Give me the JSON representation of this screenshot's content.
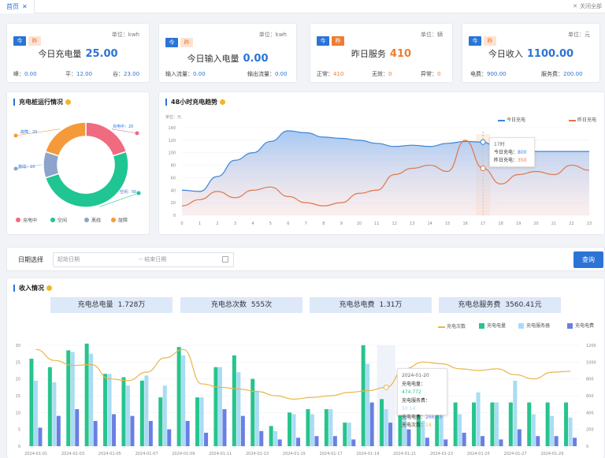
{
  "tabs": {
    "home_label": "首页",
    "close_all": "关闭全部"
  },
  "cards": [
    {
      "today_badge": "今",
      "yest_badge": "昨",
      "unit": "单位：kwh",
      "title": "今日充电量",
      "value": "25.00",
      "subs": [
        {
          "label": "峰：",
          "value": "0.00"
        },
        {
          "label": "平：",
          "value": "12.00"
        },
        {
          "label": "谷：",
          "value": "23.00"
        }
      ]
    },
    {
      "today_badge": "今",
      "yest_badge": "昨",
      "unit": "单位：kwh",
      "title": "今日输入电量",
      "value": "0.00",
      "subs": [
        {
          "label": "输入流量：",
          "value": "0.00"
        },
        {
          "label": "输出流量：",
          "value": "0.00"
        }
      ]
    },
    {
      "today_badge": "今",
      "yest_badge": "昨",
      "unit": "单位：辆",
      "title": "昨日服务",
      "value": "410",
      "subs": [
        {
          "label": "正常：",
          "value": "410"
        },
        {
          "label": "无效：",
          "value": "0"
        },
        {
          "label": "异常：",
          "value": "0"
        }
      ]
    },
    {
      "today_badge": "今",
      "yest_badge": "昨",
      "unit": "单位：元",
      "title": "今日收入",
      "value": "1100.00",
      "subs": [
        {
          "label": "电费：",
          "value": "900.00"
        },
        {
          "label": "服务费：",
          "value": "200.00"
        }
      ]
    }
  ],
  "pile_status": {
    "title": "充电桩运行情况",
    "chart_data": {
      "type": "pie",
      "categories": [
        "充电中",
        "空闲",
        "离线",
        "故障"
      ],
      "values": [
        20,
        50,
        10,
        20
      ],
      "colors": [
        "#f06b7f",
        "#1fc592",
        "#8da3c9",
        "#f59a3a"
      ],
      "slice_labels": [
        "充电中：20",
        "空闲：50",
        "离线：10",
        "故障：20"
      ]
    }
  },
  "trend48": {
    "title": "48小时充电趋势",
    "unit_label": "单位：元",
    "legend": [
      "今日充电",
      "昨日充电"
    ],
    "tooltip": {
      "title": "17时",
      "lines": [
        {
          "label": "今日充电：",
          "value": "800"
        },
        {
          "label": "昨日充电：",
          "value": "350"
        }
      ]
    },
    "chart_data": {
      "type": "area",
      "x": [
        "0",
        "1",
        "2",
        "3",
        "4",
        "5",
        "6",
        "7",
        "8",
        "9",
        "10",
        "11",
        "12",
        "13",
        "14",
        "15",
        "16",
        "17",
        "18",
        "19",
        "20",
        "21",
        "22",
        "23"
      ],
      "ylim": [
        0,
        140
      ],
      "yticks": [
        "0",
        "20",
        "40",
        "60",
        "80",
        "100",
        "120",
        "140"
      ],
      "series": [
        {
          "name": "今日充电",
          "color": "#3b86d8",
          "values": [
            40,
            38,
            62,
            88,
            100,
            118,
            135,
            132,
            125,
            123,
            120,
            115,
            110,
            112,
            110,
            115,
            118,
            117,
            102,
            102,
            102,
            102,
            102,
            102
          ]
        },
        {
          "name": "昨日充电",
          "color": "#e0764a",
          "values": [
            15,
            25,
            38,
            28,
            40,
            45,
            30,
            20,
            15,
            20,
            35,
            40,
            65,
            75,
            80,
            70,
            120,
            75,
            50,
            65,
            70,
            65,
            80,
            72
          ]
        }
      ]
    }
  },
  "filter": {
    "label": "日期选择",
    "start_placeholder": "起始日期",
    "end_placeholder": "结束日期",
    "query_button": "查询"
  },
  "income": {
    "title": "收入情况",
    "summary": [
      {
        "label": "充电总电量",
        "value": "1.728万"
      },
      {
        "label": "充电总次数",
        "value": "555次"
      },
      {
        "label": "充电总电费",
        "value": "1.31万"
      },
      {
        "label": "充电总服务费",
        "value": "3560.41元"
      }
    ],
    "legend": [
      "充电次数",
      "充电电量",
      "充电服务器",
      "充电电费"
    ],
    "tooltip": {
      "title": "2024-01-20",
      "lines": [
        {
          "label": "充电电量：",
          "value": "474.772"
        },
        {
          "label": "充电服务费：",
          "value": "50.14"
        },
        {
          "label": "充电电费：",
          "value": "266.53"
        },
        {
          "label": "充电次数：",
          "value": "14"
        }
      ]
    },
    "chart_data": {
      "type": "bar",
      "categories": [
        "2024-01-01",
        "2024-01-02",
        "2024-01-03",
        "2024-01-04",
        "2024-01-05",
        "2024-01-06",
        "2024-01-07",
        "2024-01-08",
        "2024-01-09",
        "2024-01-10",
        "2024-01-11",
        "2024-01-12",
        "2024-01-13",
        "2024-01-14",
        "2024-01-15",
        "2024-01-16",
        "2024-01-17",
        "2024-01-18",
        "2024-01-19",
        "2024-01-20",
        "2024-01-21",
        "2024-01-22",
        "2024-01-23",
        "2024-01-24",
        "2024-01-25",
        "2024-01-26",
        "2024-01-27",
        "2024-01-28",
        "2024-01-29",
        "2024-01-30"
      ],
      "xtick_labels": [
        "2024-01-01",
        "2024-01-03",
        "2024-01-05",
        "2024-01-07",
        "2024-01-09",
        "2024-01-11",
        "2024-01-13",
        "2024-01-15",
        "2024-01-17",
        "2024-01-19",
        "2024-01-21",
        "2024-01-23",
        "2024-01-25",
        "2024-01-27",
        "2024-01-29"
      ],
      "ylim_left": [
        0,
        30
      ],
      "yticks_left": [
        "0",
        "5",
        "10",
        "15",
        "20",
        "25",
        "30"
      ],
      "ylim_right": [
        0,
        1200
      ],
      "yticks_right": [
        "0",
        "200",
        "400",
        "600",
        "800",
        "1000",
        "1200"
      ],
      "series": [
        {
          "name": "充电电量",
          "color": "#27c48d",
          "values": [
            26,
            23.5,
            28.5,
            30.5,
            21.5,
            20.5,
            19.5,
            14.5,
            29.5,
            14.5,
            23.5,
            27,
            20,
            6,
            10,
            11,
            11,
            7,
            30,
            14,
            14,
            13,
            13,
            13,
            13,
            13,
            13,
            13,
            13,
            13
          ]
        },
        {
          "name": "充电服务器",
          "color": "#a9dcf4",
          "values": [
            19.5,
            19,
            28,
            27.5,
            21.5,
            18,
            21,
            18,
            27,
            14.5,
            23.5,
            22,
            16.5,
            4.5,
            9.5,
            9.5,
            11,
            7,
            24.5,
            11,
            9,
            7.5,
            10,
            9.5,
            16,
            13,
            19.5,
            9.5,
            9,
            8.5
          ]
        },
        {
          "name": "充电电费",
          "color": "#6a7fe3",
          "values": [
            5.5,
            9,
            11,
            7.5,
            9.5,
            9,
            7.5,
            5,
            7.5,
            4,
            11,
            9,
            4.5,
            2,
            2.5,
            3,
            3,
            2,
            13,
            7,
            5,
            2.5,
            2,
            4,
            3,
            2,
            5,
            3,
            3,
            2.5
          ]
        },
        {
          "name": "充电次数",
          "color": "#eab54a",
          "axis": "right",
          "values": [
            1150,
            1020,
            960,
            970,
            800,
            780,
            880,
            1050,
            1150,
            740,
            700,
            680,
            650,
            600,
            560,
            580,
            600,
            640,
            660,
            700,
            920,
            1000,
            980,
            920,
            900,
            920,
            850,
            800,
            880,
            890
          ]
        }
      ]
    }
  }
}
